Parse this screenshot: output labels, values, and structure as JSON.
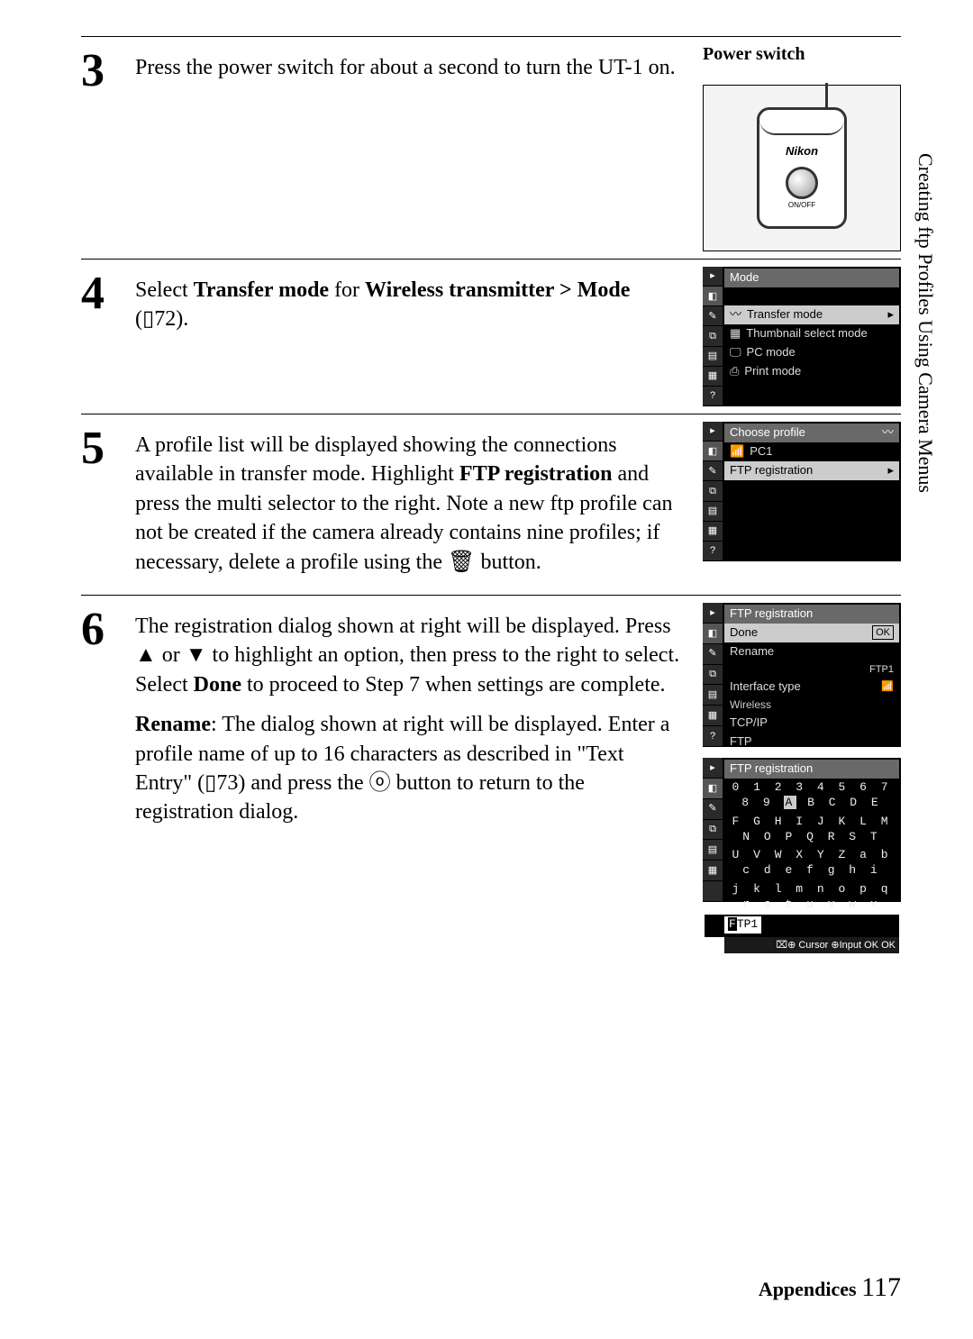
{
  "side_label": "Creating ftp Profiles Using Camera Menus",
  "steps": {
    "s3": {
      "num": "3",
      "text": "Press the power switch for about a second to turn the UT-1 on.",
      "caption": "Power switch",
      "device": {
        "brand": "Nikon",
        "onoff": "ON/OFF"
      }
    },
    "s4": {
      "num": "4",
      "text_a": "Select ",
      "text_b": "Transfer mode",
      "text_c": " for ",
      "text_d": "Wireless transmitter",
      "text_e": " > ",
      "text_f": "Mode",
      "text_g": " (",
      "page_ref": "72",
      "text_h": ").",
      "menu": {
        "header": "Mode",
        "items": [
          "Transfer mode",
          "Thumbnail select mode",
          "PC mode",
          "Print mode"
        ]
      }
    },
    "s5": {
      "num": "5",
      "text_a": "A profile list will be displayed showing the connections available in transfer mode. Highlight ",
      "text_b": "FTP registration",
      "text_c": " and press the multi selector to the right. Note a new ftp profile can not be created if the camera already contains nine profiles; if necessary, delete a profile using the ",
      "text_d": " button.",
      "menu": {
        "header": "Choose profile",
        "row1": "PC1",
        "row2": "FTP registration"
      }
    },
    "s6": {
      "num": "6",
      "p1_a": "The registration dialog shown at right will be displayed. Press ",
      "p1_b": " or ",
      "p1_c": " to highlight an option, then press to the right to select. Select ",
      "p1_d": "Done",
      "p1_e": " to proceed to Step 7 when settings are complete.",
      "p2_a": "Rename",
      "p2_b": ": The dialog shown at right will be displayed. Enter a profile name of up to 16 characters as described in \"Text Entry\" (",
      "page_ref": "73",
      "p2_c": ") and press the ",
      "p2_d": " button to return to the registration dialog.",
      "menu1": {
        "header": "FTP registration",
        "done": "Done",
        "ok": "OK",
        "rename": "Rename",
        "rename_val": "FTP1",
        "iface": "Interface type",
        "wireless": "Wireless",
        "tcpip": "TCP/IP",
        "ftp": "FTP"
      },
      "menu2": {
        "header": "FTP registration",
        "row1": "0 1 2 3 4 5 6 7 8 9 A B C D E",
        "hi": "A",
        "row2": "F G H I J K L M N O P Q R S T",
        "row3": "U V W X Y Z a b c d e f g h i",
        "row4": "j k l m n o p q r s t u v w x",
        "input_cur": "F",
        "input_rest": "TP1",
        "footer": "Cursor   ⊕Input   OK OK"
      }
    }
  },
  "footer": {
    "label": "Appendices",
    "page": "117"
  }
}
